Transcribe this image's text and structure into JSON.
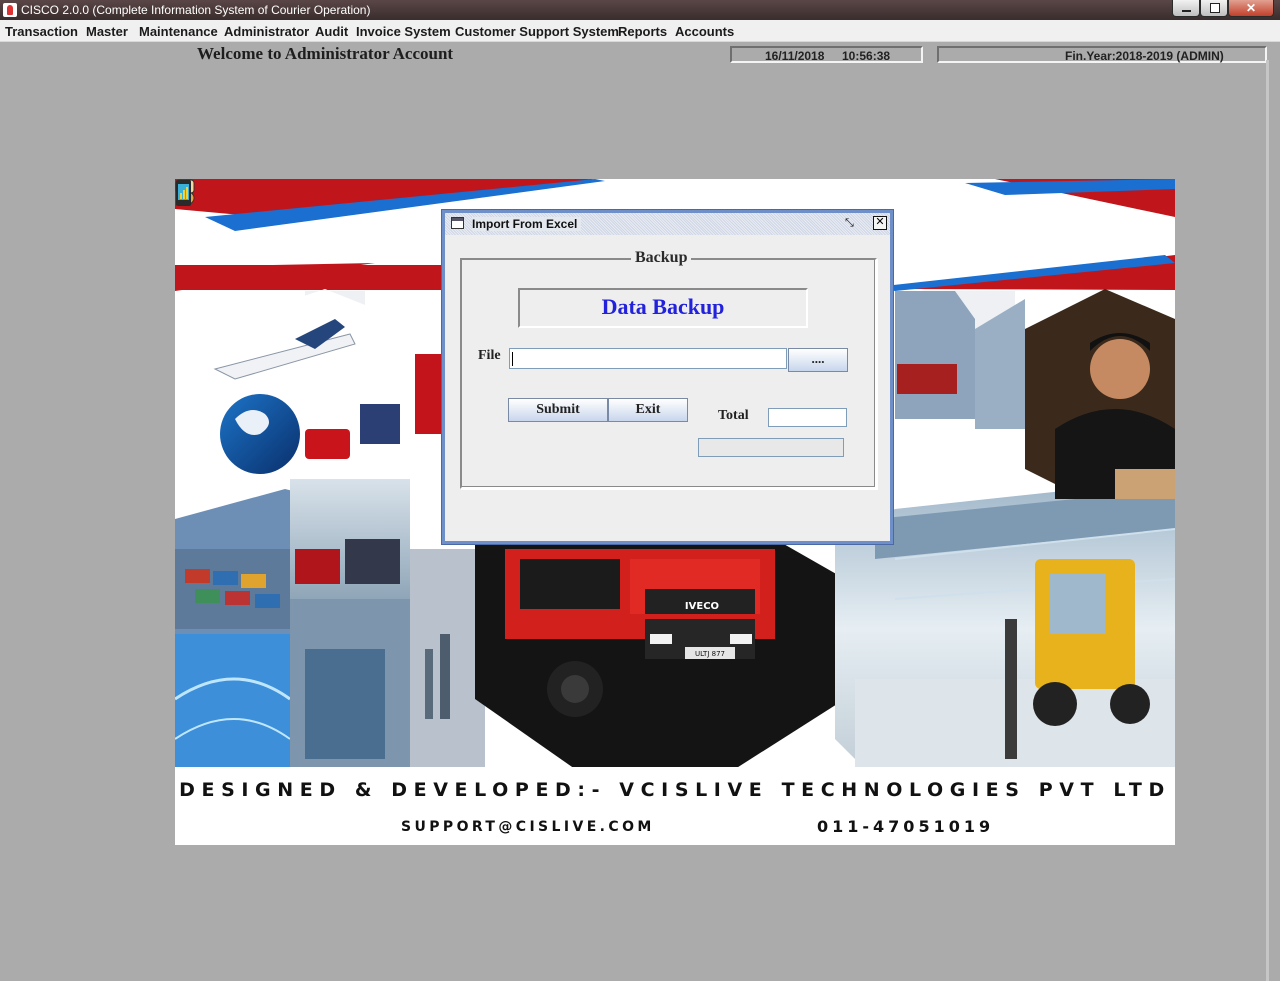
{
  "window": {
    "title": "CISCO 2.0.0 (Complete Information System of Courier Operation)"
  },
  "menu": [
    {
      "label": "Transaction"
    },
    {
      "label": "Master"
    },
    {
      "label": "Maintenance"
    },
    {
      "label": "Administrator"
    },
    {
      "label": "Audit"
    },
    {
      "label": "Invoice System"
    },
    {
      "label": "Customer Support System"
    },
    {
      "label": "Reports"
    },
    {
      "label": "Accounts"
    }
  ],
  "header": {
    "welcome": "Welcome to Administrator Account",
    "date": "16/11/2018",
    "time": "10:56:38",
    "fin_year": "Fin.Year:2018-2019  (ADMIN)"
  },
  "banner": {
    "designed_by": "DESIGNED & DEVELOPED:- VCISLIVE TECHNOLOGIES PVT LTD",
    "support_email": "SUPPORT@CISLIVE.COM",
    "phone": "011-47051019",
    "truck_brand": "IVECO",
    "truck_plate": "ULTJ 877"
  },
  "dialog": {
    "title": "Import From Excel",
    "group_title": "Backup",
    "heading": "Data Backup",
    "file_label": "File",
    "file_value": "",
    "browse_label": "....",
    "submit_label": "Submit",
    "exit_label": "Exit",
    "total_label": "Total",
    "total_value": "",
    "progress": 0
  },
  "colors": {
    "titlebar": "#4a3a3a",
    "dialog_border": "#6f8fc9",
    "heading_text": "#2222dd",
    "desktop": "#ababab"
  }
}
